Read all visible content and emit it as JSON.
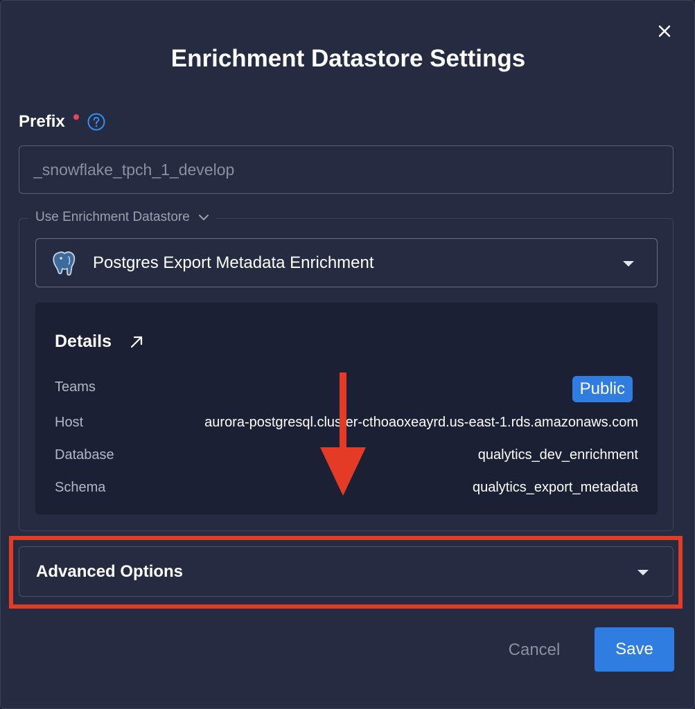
{
  "modal": {
    "title": "Enrichment Datastore Settings"
  },
  "prefix": {
    "label": "Prefix",
    "required": true,
    "help_icon": "question-circle-icon",
    "placeholder": "_snowflake_tpch_1_develop"
  },
  "enrichment": {
    "legend": "Use Enrichment Datastore",
    "selected_icon": "postgres-elephant-icon",
    "selected": "Postgres Export Metadata Enrichment"
  },
  "details": {
    "title": "Details",
    "rows": [
      {
        "key": "Teams",
        "value": "Public"
      },
      {
        "key": "Host",
        "value": "aurora-postgresql.cluster-cthoaoxeayrd.us-east-1.rds.amazonaws.com"
      },
      {
        "key": "Database",
        "value": "qualytics_dev_enrichment"
      },
      {
        "key": "Schema",
        "value": "qualytics_export_metadata"
      }
    ]
  },
  "advanced": {
    "label": "Advanced Options"
  },
  "actions": {
    "cancel": "Cancel",
    "save": "Save"
  },
  "colors": {
    "background": "#252b40",
    "accent": "#2f7de1",
    "annotation": "#e33b26",
    "required": "#e8455d"
  }
}
